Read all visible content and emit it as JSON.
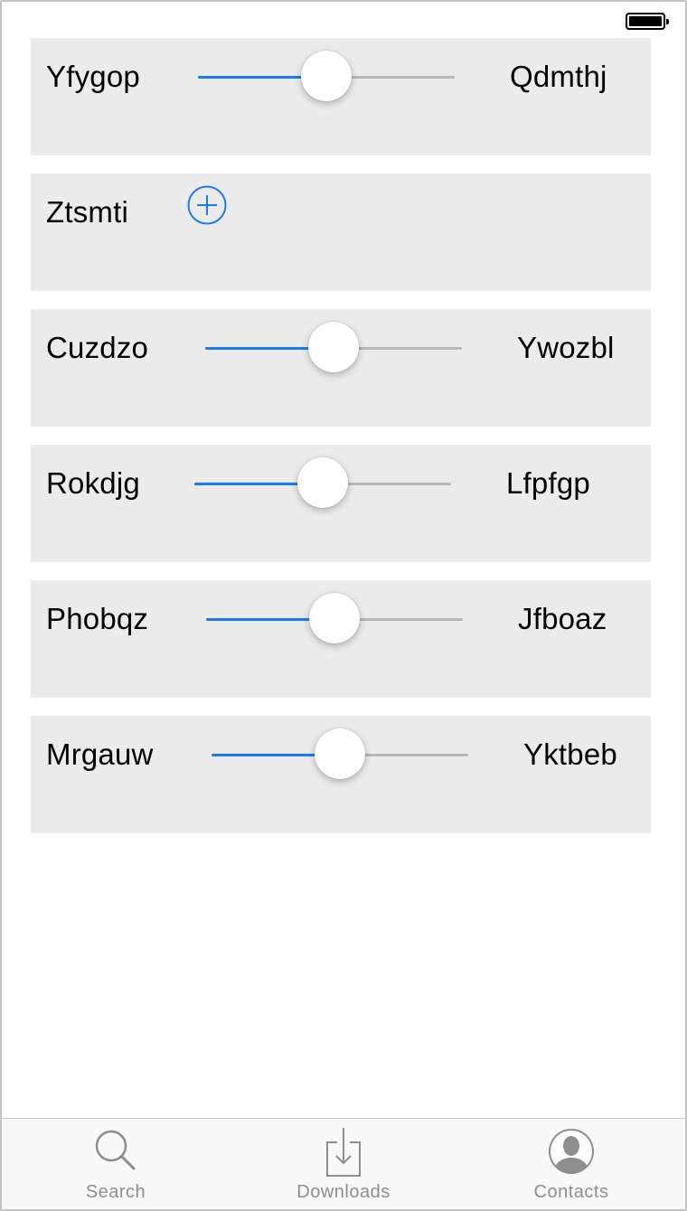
{
  "status_bar": {
    "battery_icon": "battery-full-icon"
  },
  "rows": [
    {
      "type": "slider",
      "left_label": "Yfygop",
      "right_label": "Qdmthj",
      "value": 0.5
    },
    {
      "type": "add",
      "left_label": "Ztsmti",
      "icon": "add-circle-icon"
    },
    {
      "type": "slider",
      "left_label": "Cuzdzo",
      "right_label": "Ywozbl",
      "value": 0.5
    },
    {
      "type": "slider",
      "left_label": "Rokdjg",
      "right_label": "Lfpfgp",
      "value": 0.5
    },
    {
      "type": "slider",
      "left_label": "Phobqz",
      "right_label": "Jfboaz",
      "value": 0.5
    },
    {
      "type": "slider",
      "left_label": "Mrgauw",
      "right_label": "Yktbeb",
      "value": 0.5
    }
  ],
  "tabbar": {
    "tabs": [
      {
        "label": "Search",
        "icon": "search-icon"
      },
      {
        "label": "Downloads",
        "icon": "downloads-icon"
      },
      {
        "label": "Contacts",
        "icon": "contacts-icon"
      }
    ]
  },
  "colors": {
    "accent": "#1a7cf5",
    "row_bg": "#ebebeb",
    "track": "#b8b8b8",
    "tab_label": "#8e8e8e"
  }
}
